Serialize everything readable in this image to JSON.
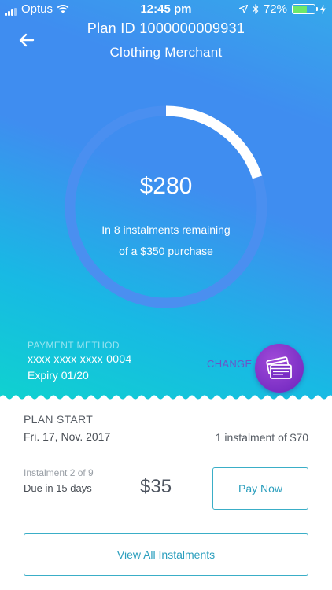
{
  "status_bar": {
    "carrier": "Optus",
    "time": "12:45 pm",
    "battery_percent": "72%",
    "battery_level": 0.72
  },
  "header": {
    "title": "Plan ID 1000000009931",
    "subtitle": "Clothing Merchant"
  },
  "plan_summary": {
    "remaining_amount": "$280",
    "remaining_line1": "In 8 instalments remaining",
    "remaining_line2": "of a $350 purchase",
    "paid_fraction": 0.2
  },
  "payment_method": {
    "label": "PAYMENT METHOD",
    "card_number": "xxxx xxxx xxxx 0004",
    "expiry": "Expiry 01/20",
    "change_label": "CHANGE"
  },
  "plan_start": {
    "label": "PLAN START",
    "date": "Fri. 17, Nov. 2017",
    "first_instalment": "1 instalment of $70"
  },
  "instalment": {
    "label": "Instalment 2 of 9",
    "due": "Due in 15 days",
    "amount": "$35",
    "pay_button": "Pay Now"
  },
  "view_all_button": "View All Instalments",
  "colors": {
    "accent": "#2a9ebd",
    "card_button": "#7b2fc5",
    "ring_track": "#4a8ff0",
    "ring_progress": "#ffffff"
  }
}
